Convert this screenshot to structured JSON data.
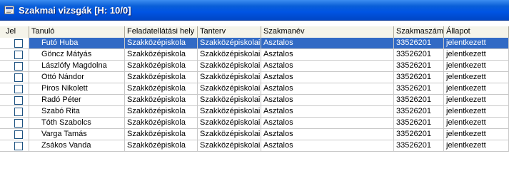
{
  "window": {
    "title": "Szakmai vizsgák [H: 10/0]",
    "icon": "window-list-icon"
  },
  "table": {
    "columns": [
      "Jel",
      "Tanuló",
      "Feladatellátási hely",
      "Tanterv",
      "Szakmanév",
      "Szakmaszám",
      "Állapot"
    ],
    "rows": [
      {
        "name": "Futó Huba",
        "hely": "Szakközépiskola",
        "tanterv": "Szakközépiskolai",
        "szakmanev": "Asztalos",
        "szakmaszam": "33526201",
        "allapot": "jelentkezett",
        "selected": true
      },
      {
        "name": "Göncz  Mátyás",
        "hely": "Szakközépiskola",
        "tanterv": "Szakközépiskolai",
        "szakmanev": "Asztalos",
        "szakmaszam": "33526201",
        "allapot": "jelentkezett"
      },
      {
        "name": "Lászlófy Magdolna",
        "hely": "Szakközépiskola",
        "tanterv": "Szakközépiskolai",
        "szakmanev": "Asztalos",
        "szakmaszam": "33526201",
        "allapot": "jelentkezett"
      },
      {
        "name": "Ottó Nándor",
        "hely": "Szakközépiskola",
        "tanterv": "Szakközépiskolai",
        "szakmanev": "Asztalos",
        "szakmaszam": "33526201",
        "allapot": "jelentkezett"
      },
      {
        "name": "Piros Nikolett",
        "hely": "Szakközépiskola",
        "tanterv": "Szakközépiskolai",
        "szakmanev": "Asztalos",
        "szakmaszam": "33526201",
        "allapot": "jelentkezett"
      },
      {
        "name": "Radó Péter",
        "hely": "Szakközépiskola",
        "tanterv": "Szakközépiskolai",
        "szakmanev": "Asztalos",
        "szakmaszam": "33526201",
        "allapot": "jelentkezett"
      },
      {
        "name": "Szabó Rita",
        "hely": "Szakközépiskola",
        "tanterv": "Szakközépiskolai",
        "szakmanev": "Asztalos",
        "szakmaszam": "33526201",
        "allapot": "jelentkezett"
      },
      {
        "name": "Tóth Szabolcs",
        "hely": "Szakközépiskola",
        "tanterv": "Szakközépiskolai",
        "szakmanev": "Asztalos",
        "szakmaszam": "33526201",
        "allapot": "jelentkezett"
      },
      {
        "name": "Varga Tamás",
        "hely": "Szakközépiskola",
        "tanterv": "Szakközépiskolai",
        "szakmanev": "Asztalos",
        "szakmaszam": "33526201",
        "allapot": "jelentkezett"
      },
      {
        "name": "Zsákos Vanda",
        "hely": "Szakközépiskola",
        "tanterv": "Szakközépiskolai",
        "szakmanev": "Asztalos",
        "szakmaszam": "33526201",
        "allapot": "jelentkezett"
      }
    ]
  },
  "colors": {
    "title_bar": "#0054e3",
    "selection": "#316ac5",
    "header_bg": "#ece9d8"
  }
}
